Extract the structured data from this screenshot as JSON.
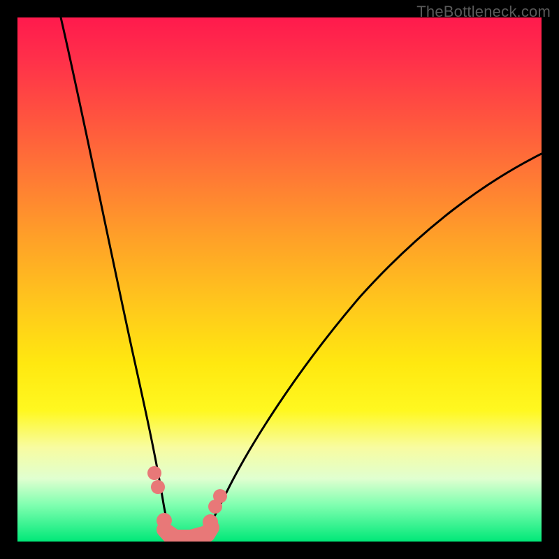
{
  "watermark": "TheBottleneck.com",
  "chart_data": {
    "type": "line",
    "title": "",
    "xlabel": "",
    "ylabel": "",
    "xlim": [
      0,
      100
    ],
    "ylim": [
      0,
      100
    ],
    "axes_hidden": true,
    "grid": false,
    "background_gradient": {
      "top": "#ff1a4d",
      "bottom": "#00e878",
      "meaning": "red = high bottleneck, green = low bottleneck"
    },
    "series": [
      {
        "name": "left-branch",
        "x": [
          8,
          10,
          12,
          14,
          16,
          18,
          20,
          22,
          24,
          25,
          26,
          27,
          28
        ],
        "y": [
          100,
          88,
          76,
          65,
          54,
          43,
          33,
          24,
          15,
          11,
          8,
          5,
          3
        ]
      },
      {
        "name": "right-branch",
        "x": [
          36,
          38,
          41,
          45,
          50,
          56,
          63,
          71,
          80,
          90,
          100
        ],
        "y": [
          3,
          6,
          11,
          18,
          26,
          34,
          42,
          50,
          58,
          65,
          72
        ]
      }
    ],
    "optimal_region": {
      "x_range": [
        27,
        36
      ],
      "y": 2,
      "marker_color": "#e87878"
    },
    "highlight_points": [
      {
        "x": 24.5,
        "y": 13
      },
      {
        "x": 25.3,
        "y": 10
      },
      {
        "x": 36.5,
        "y": 7
      },
      {
        "x": 37.8,
        "y": 9
      }
    ]
  }
}
